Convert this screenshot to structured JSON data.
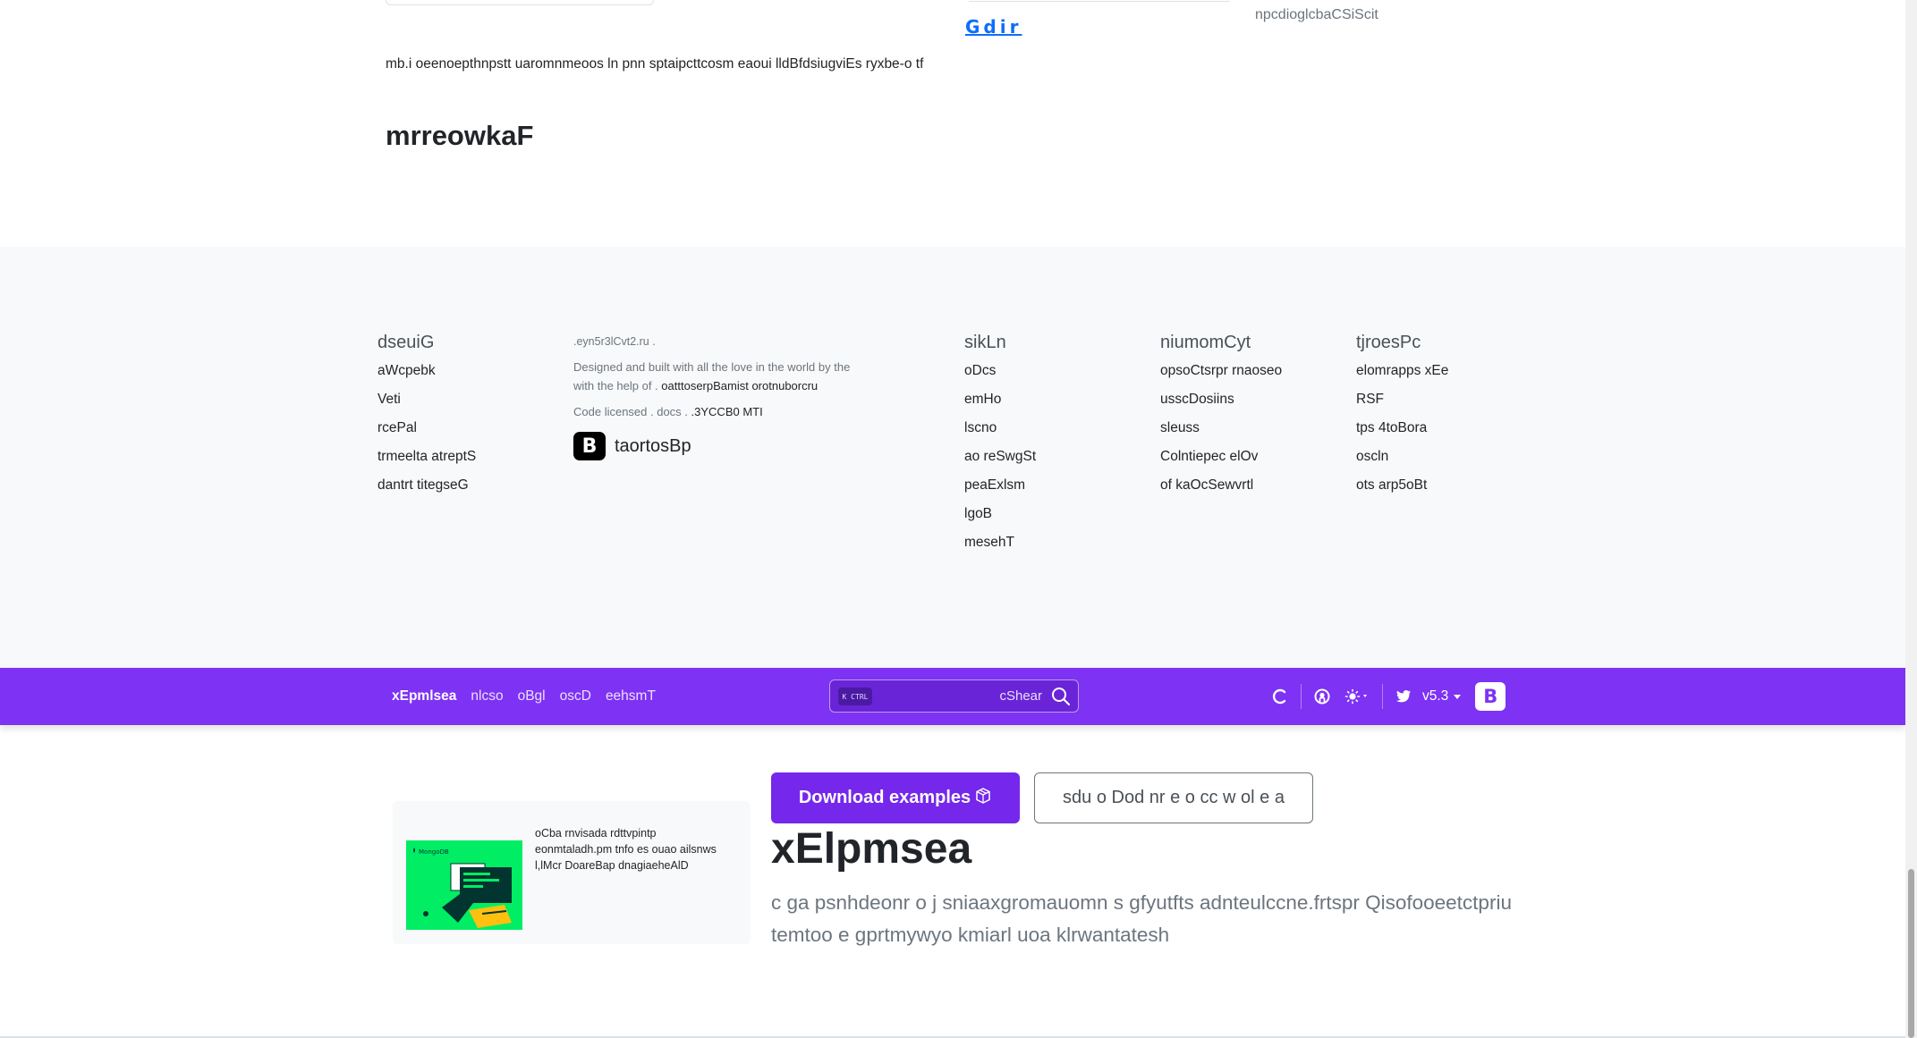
{
  "top": {
    "faint_text": "",
    "link_text": "Gdir",
    "right_text": "npcdioglcbaCSiScit",
    "paragraph": "mb.i oeenoepthnpstt uaromnmeoos ln pnn sptaipcttcosm eaoui lldBfdsiugviEs ryxbe-o tf",
    "heading": "mrreowkaF"
  },
  "footer": {
    "brand": {
      "version_line": ".eyn5r3lCvt2.ru .",
      "designed_text": "Designed and built with all the love in the world by the with the help of .",
      "designed_link": "oatttoserpBamist orotnuborcru",
      "license_text": "Code licensed . docs .",
      "license_link": ".3YCCB0 MTI",
      "logo_letter": "B",
      "name": "taortosBp"
    },
    "columns": [
      {
        "title": "dseuiG",
        "items": [
          "aWcpebk",
          "Veti",
          "rcePal",
          "trmeelta atreptS",
          "dantrt titegseG"
        ]
      },
      {
        "title": "sikLn",
        "items": [
          "oDcs",
          "emHo",
          "lscno",
          "ao reSwgSt",
          "peaExlsm",
          "lgoB",
          "mesehT"
        ]
      },
      {
        "title": "niumomCyt",
        "items": [
          "opsoCtsrpr rnaoseo",
          "usscDosiins",
          "sleuss",
          "Colntiepec elOv",
          "of kaOcSewvrtl"
        ]
      },
      {
        "title": "tjroesPc",
        "items": [
          "elomrapps xEe",
          "RSF",
          "tps 4toBora",
          "oscln",
          "ots arp5oBt"
        ]
      }
    ]
  },
  "navbar": {
    "links": [
      "xEpmlsea",
      "nlcso",
      "oBgl",
      "oscD",
      "eehsmT"
    ],
    "active_index": 0,
    "search": {
      "kbd": "K CTRL",
      "placeholder": "cShear"
    },
    "version": "v5.3",
    "brand_letter": "B",
    "colors": {
      "background": "#7e32f4"
    },
    "icons": [
      "loader-icon",
      "github-icon",
      "sun-icon",
      "twitter-icon"
    ]
  },
  "ad": {
    "text": "oCba rnvisada rdttvpintp eonmtaladh.pm tnfo es ouao ailsnws l,lMcr DoareBap dnagiaeheAlD",
    "image_label": "MongoDB"
  },
  "main": {
    "download_button": "Download examples",
    "outline_button": "sdu o Dod nr e o cc w ol e a",
    "title": "xElpmsea",
    "lead": "c ga psnhdeonr o j sniaaxgromauomn s gfyutfts adnteulccne.frtspr Qisofooeetctpriu temtoo e gprtmywyo kmiarl uoa klrwantatesh"
  }
}
